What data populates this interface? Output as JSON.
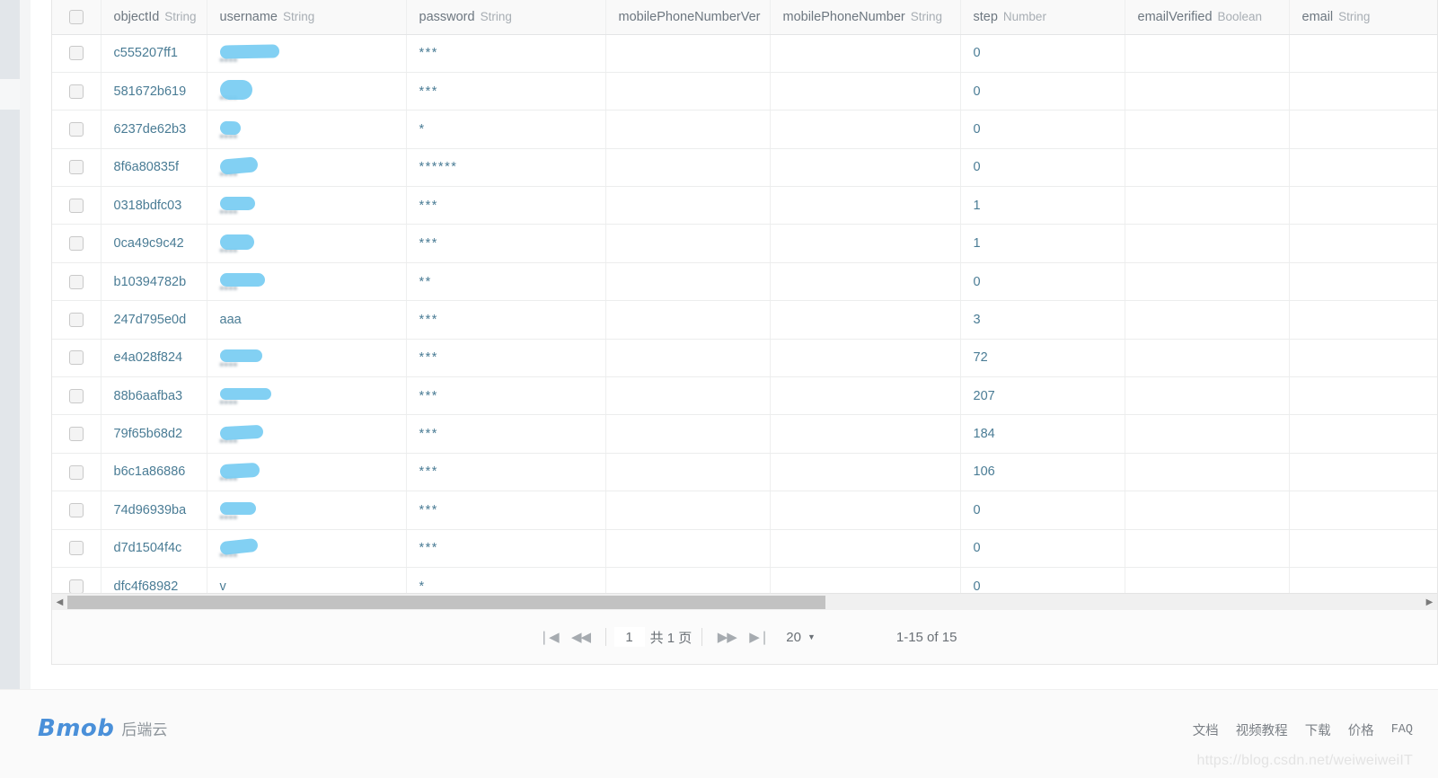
{
  "table": {
    "columns": [
      {
        "name": "",
        "type": "",
        "kind": "checkbox"
      },
      {
        "name": "objectId",
        "type": "String"
      },
      {
        "name": "username",
        "type": "String"
      },
      {
        "name": "password",
        "type": "String"
      },
      {
        "name": "mobilePhoneNumberVer",
        "type": ""
      },
      {
        "name": "mobilePhoneNumber",
        "type": "String"
      },
      {
        "name": "step",
        "type": "Number"
      },
      {
        "name": "emailVerified",
        "type": "Boolean"
      },
      {
        "name": "email",
        "type": "String"
      }
    ],
    "rows": [
      {
        "objectId": "c555207ff1",
        "username": "",
        "username_redacted": true,
        "redact_w": 66,
        "redact_h": 15,
        "redact_skew": "-1deg",
        "password": "***",
        "mobilePhoneNumberVerified": "",
        "mobilePhoneNumber": "",
        "step": "0",
        "emailVerified": "",
        "email": ""
      },
      {
        "objectId": "581672b619",
        "username": "",
        "username_redacted": true,
        "redact_w": 36,
        "redact_h": 22,
        "redact_skew": "0deg",
        "password": "***",
        "mobilePhoneNumberVerified": "",
        "mobilePhoneNumber": "",
        "step": "0",
        "emailVerified": "",
        "email": ""
      },
      {
        "objectId": "6237de62b3",
        "username": "",
        "username_redacted": true,
        "redact_w": 23,
        "redact_h": 15,
        "redact_skew": "2deg",
        "password": "*",
        "mobilePhoneNumberVerified": "",
        "mobilePhoneNumber": "",
        "step": "0",
        "emailVerified": "",
        "email": ""
      },
      {
        "objectId": "8f6a80835f",
        "username": "",
        "username_redacted": true,
        "redact_w": 42,
        "redact_h": 17,
        "redact_skew": "-5deg",
        "password": "******",
        "mobilePhoneNumberVerified": "",
        "mobilePhoneNumber": "",
        "step": "0",
        "emailVerified": "",
        "email": ""
      },
      {
        "objectId": "0318bdfc03",
        "username": "",
        "username_redacted": true,
        "redact_w": 39,
        "redact_h": 15,
        "redact_skew": "0deg",
        "password": "***",
        "mobilePhoneNumberVerified": "",
        "mobilePhoneNumber": "",
        "step": "1",
        "emailVerified": "",
        "email": ""
      },
      {
        "objectId": "0ca49c9c42",
        "username": "",
        "username_redacted": true,
        "redact_w": 38,
        "redact_h": 17,
        "redact_skew": "0deg",
        "password": "***",
        "mobilePhoneNumberVerified": "",
        "mobilePhoneNumber": "",
        "step": "1",
        "emailVerified": "",
        "email": ""
      },
      {
        "objectId": "b10394782b",
        "username": "",
        "username_redacted": true,
        "redact_w": 50,
        "redact_h": 15,
        "redact_skew": "0deg",
        "password": "**",
        "mobilePhoneNumberVerified": "",
        "mobilePhoneNumber": "",
        "step": "0",
        "emailVerified": "",
        "email": ""
      },
      {
        "objectId": "247d795e0d",
        "username": "aaa",
        "username_redacted": false,
        "password": "***",
        "mobilePhoneNumberVerified": "",
        "mobilePhoneNumber": "",
        "step": "3",
        "emailVerified": "",
        "email": ""
      },
      {
        "objectId": "e4a028f824",
        "username": "",
        "username_redacted": true,
        "redact_w": 47,
        "redact_h": 14,
        "redact_skew": "0deg",
        "password": "***",
        "mobilePhoneNumberVerified": "",
        "mobilePhoneNumber": "",
        "step": "72",
        "emailVerified": "",
        "email": ""
      },
      {
        "objectId": "88b6aafba3",
        "username": "",
        "username_redacted": true,
        "redact_w": 57,
        "redact_h": 13,
        "redact_skew": "0deg",
        "password": "***",
        "mobilePhoneNumberVerified": "",
        "mobilePhoneNumber": "",
        "step": "207",
        "emailVerified": "",
        "email": ""
      },
      {
        "objectId": "79f65b68d2",
        "username": "",
        "username_redacted": true,
        "redact_w": 48,
        "redact_h": 15,
        "redact_skew": "-3deg",
        "password": "***",
        "mobilePhoneNumberVerified": "",
        "mobilePhoneNumber": "",
        "step": "184",
        "emailVerified": "",
        "email": ""
      },
      {
        "objectId": "b6c1a86886",
        "username": "",
        "username_redacted": true,
        "redact_w": 44,
        "redact_h": 16,
        "redact_skew": "-3deg",
        "password": "***",
        "mobilePhoneNumberVerified": "",
        "mobilePhoneNumber": "",
        "step": "106",
        "emailVerified": "",
        "email": ""
      },
      {
        "objectId": "74d96939ba",
        "username": "",
        "username_redacted": true,
        "redact_w": 40,
        "redact_h": 14,
        "redact_skew": "0deg",
        "password": "***",
        "mobilePhoneNumberVerified": "",
        "mobilePhoneNumber": "",
        "step": "0",
        "emailVerified": "",
        "email": ""
      },
      {
        "objectId": "d7d1504f4c",
        "username": "",
        "username_redacted": true,
        "redact_w": 42,
        "redact_h": 15,
        "redact_skew": "-6deg",
        "password": "***",
        "mobilePhoneNumberVerified": "",
        "mobilePhoneNumber": "",
        "step": "0",
        "emailVerified": "",
        "email": ""
      },
      {
        "objectId": "dfc4f68982",
        "username": "v",
        "username_redacted": false,
        "password": "*",
        "mobilePhoneNumberVerified": "",
        "mobilePhoneNumber": "",
        "step": "0",
        "emailVerified": "",
        "email": ""
      }
    ]
  },
  "scrollbar": {
    "left_arrow": "◀",
    "right_arrow": "▶",
    "thumb_percent": 56
  },
  "pager": {
    "first_label": "❘◀",
    "prev_label": "◀◀",
    "page_value": "1",
    "total_pages_label": "共 1 页",
    "next_label": "▶▶",
    "last_label": "▶❘",
    "page_size": "20",
    "page_size_caret": "▼",
    "range_label": "1-15 of 15"
  },
  "footer": {
    "logo_mark": "Bmob",
    "logo_cn": "后端云",
    "links": [
      {
        "label": "文档"
      },
      {
        "label": "视频教程"
      },
      {
        "label": "下载"
      },
      {
        "label": "价格"
      },
      {
        "label": "FAQ"
      }
    ],
    "watermark": "https://blog.csdn.net/weiweiweiIT"
  },
  "colors": {
    "accent_blue": "#4a7c95",
    "redact_blue": "#77ccf2",
    "logo_blue": "#4a90d9",
    "header_bg": "#f9f9f9",
    "footer_bg": "#fafafa"
  }
}
